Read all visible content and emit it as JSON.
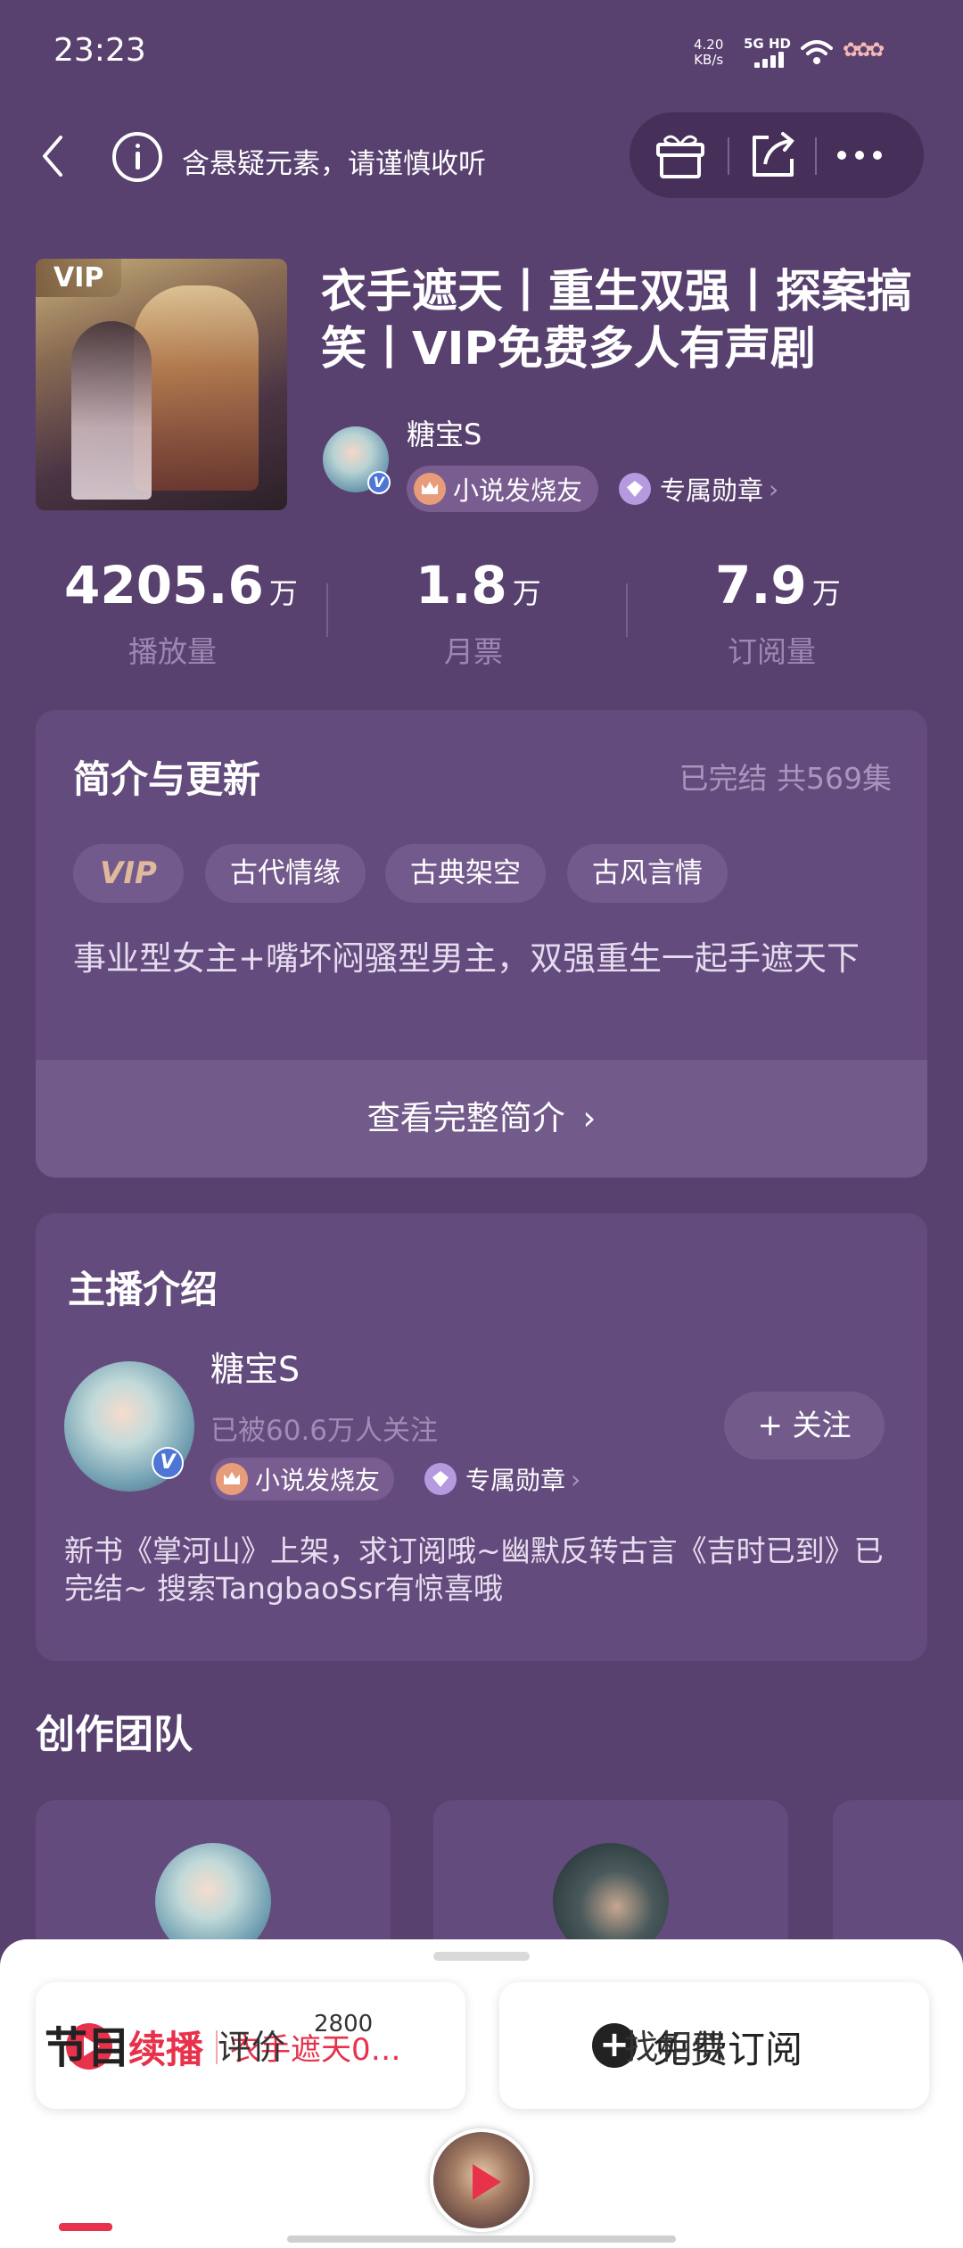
{
  "status_bar": {
    "time": "23:23",
    "speed_value": "4.20",
    "speed_unit": "KB/s",
    "network": "5G HD"
  },
  "header": {
    "warning": "含悬疑元素，请谨慎收听",
    "icons": [
      "back-icon",
      "info-icon",
      "gift-icon",
      "share-icon",
      "more-icon"
    ]
  },
  "book": {
    "cover_tag": "VIP",
    "title": "衣手遮天丨重生双强丨探案搞笑丨VIP免费多人有声剧",
    "author": "糖宝S",
    "fan_badge": "小说发烧友",
    "medal_badge": "专属勋章"
  },
  "stats": [
    {
      "value": "4205.6",
      "unit": "万",
      "label": "播放量"
    },
    {
      "value": "1.8",
      "unit": "万",
      "label": "月票"
    },
    {
      "value": "7.9",
      "unit": "万",
      "label": "订阅量"
    }
  ],
  "intro": {
    "title": "简介与更新",
    "status": "已完结 共569集",
    "tags": [
      "VIP",
      "古代情缘",
      "古典架空",
      "古风言情"
    ],
    "description": "事业型女主+嘴坏闷骚型男主，双强重生一起手遮天下",
    "more": "查看完整简介"
  },
  "anchor": {
    "title": "主播介绍",
    "name": "糖宝S",
    "followers": "已被60.6万人关注",
    "follow_label": "关注",
    "fan_badge": "小说发烧友",
    "medal_badge": "专属勋章",
    "bio": "新书《掌河山》上架，求订阅哦~幽默反转古言《吉时已到》已完结~ 搜索TangbaoSsr有惊喜哦"
  },
  "team": {
    "title": "创作团队"
  },
  "bottom": {
    "resume_label": "续播",
    "resume_episode": "衣手遮天0…",
    "subscribe_label": "免费订阅",
    "tabs": {
      "programs": "节目",
      "reviews": "评价",
      "review_count": "2800",
      "similar": "找相似"
    }
  },
  "colors": {
    "background": "#58406f",
    "card": "#644b7d",
    "accent_red": "#e8314b",
    "muted_text": "#9d88b1"
  }
}
